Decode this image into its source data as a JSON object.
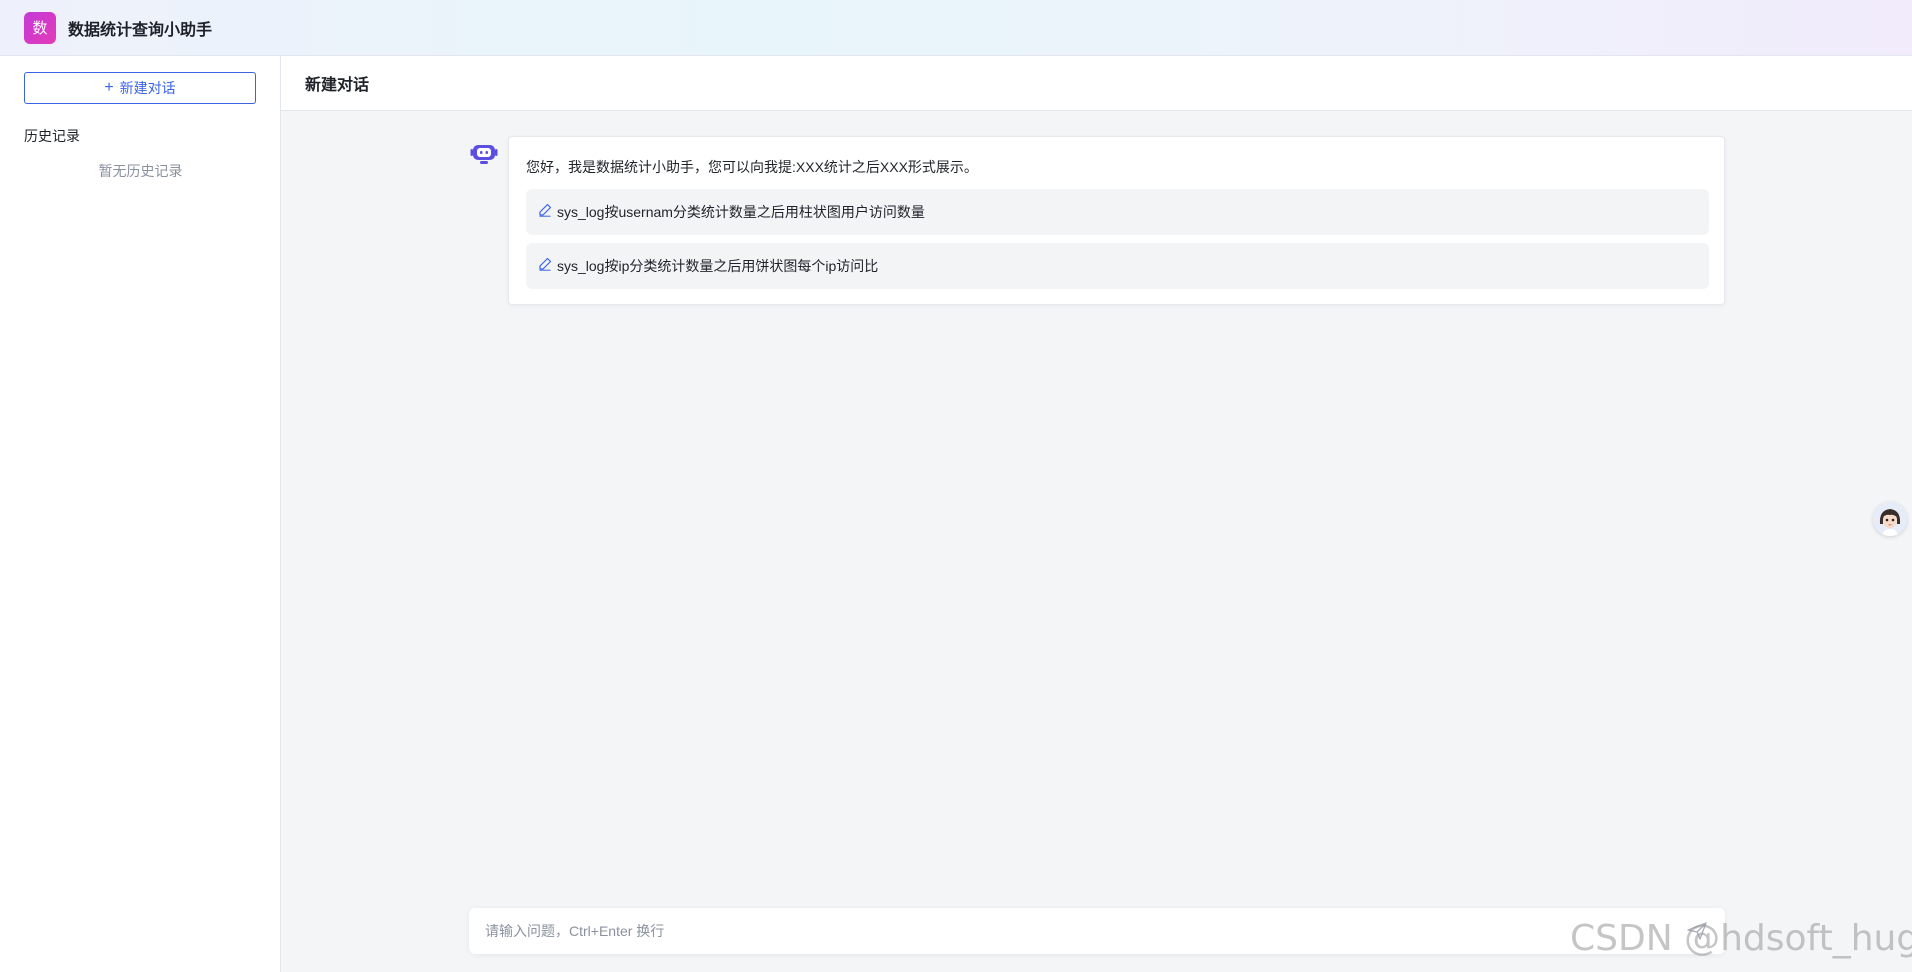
{
  "app": {
    "logo_text": "数",
    "title": "数据统计查询小助手"
  },
  "sidebar": {
    "new_chat_label": "新建对话",
    "history_title": "历史记录",
    "history_empty": "暂无历史记录"
  },
  "main": {
    "title": "新建对话",
    "greeting": "您好，我是数据统计小助手，您可以向我提:XXX统计之后XXX形式展示。",
    "suggestions": [
      {
        "text": "sys_log按usernam分类统计数量之后用柱状图用户访问数量",
        "icon": "pen-icon"
      },
      {
        "text": "sys_log按ip分类统计数量之后用饼状图每个ip访问比",
        "icon": "pen-icon"
      }
    ]
  },
  "input": {
    "placeholder": "请输入问题，Ctrl+Enter 换行",
    "value": ""
  },
  "watermark": "CSDN @hdsoft_huge",
  "colors": {
    "accent": "#3a63e8",
    "logo": "#d13bc8",
    "bot_icon": "#5b4ee0"
  }
}
